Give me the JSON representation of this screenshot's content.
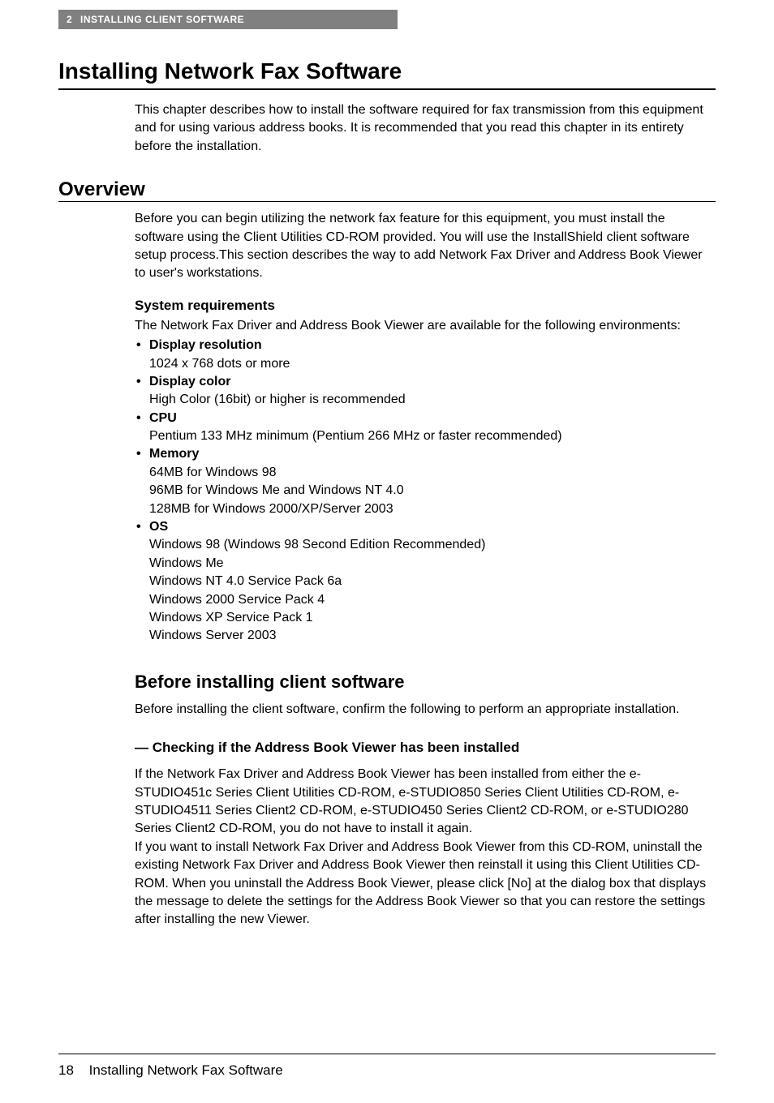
{
  "header": {
    "chapter_num": "2",
    "chapter_title": "INSTALLING CLIENT SOFTWARE"
  },
  "title": "Installing Network Fax Software",
  "intro": "This chapter describes how to install the software required for fax transmission from this equipment and for using various address books. It is recommended that you read this chapter in its entirety before the installation.",
  "overview": {
    "heading": "Overview",
    "body": "Before you can begin utilizing the network fax feature for this equipment, you must install the software using the Client Utilities CD-ROM provided. You will use the InstallShield client software setup process.This section describes the way to add Network Fax Driver and Address Book Viewer to user's workstations.",
    "sysreq_heading": "System requirements",
    "sysreq_intro": "The Network Fax Driver and Address Book Viewer are available for the following environments:",
    "requirements": [
      {
        "label": "Display resolution",
        "desc": "1024 x 768 dots or more"
      },
      {
        "label": "Display color",
        "desc": "High Color (16bit) or higher is recommended"
      },
      {
        "label": "CPU",
        "desc": "Pentium 133 MHz minimum (Pentium 266 MHz or faster recommended)"
      },
      {
        "label": "Memory",
        "desc": "64MB for Windows 98\n96MB for Windows Me and Windows NT 4.0\n128MB for Windows 2000/XP/Server 2003"
      },
      {
        "label": "OS",
        "desc": "Windows 98 (Windows 98 Second Edition Recommended)\nWindows Me\nWindows NT 4.0 Service Pack 6a\nWindows 2000 Service Pack 4\nWindows XP Service Pack 1\nWindows Server 2003"
      }
    ]
  },
  "before_install": {
    "heading": "Before installing client software",
    "body": "Before installing the client software, confirm the following to perform an appropriate installation.",
    "check_heading": "— Checking if the Address Book Viewer has been installed",
    "check_body": "If the Network Fax Driver and Address Book Viewer has been installed from either the e-STUDIO451c Series Client Utilities CD-ROM, e-STUDIO850 Series Client Utilities CD-ROM, e-STUDIO4511 Series Client2 CD-ROM, e-STUDIO450 Series Client2 CD-ROM, or e-STUDIO280 Series Client2 CD-ROM, you do not have to install it again.\nIf you want to install Network Fax Driver and Address Book Viewer from this CD-ROM, uninstall the existing Network Fax Driver and Address Book Viewer then reinstall it using this Client Utilities CD-ROM. When you uninstall the Address Book Viewer, please click [No] at the dialog box that displays the message to delete the settings for the Address Book Viewer so that you can restore the settings after installing the new Viewer."
  },
  "footer": {
    "page_num": "18",
    "footer_title": "Installing Network Fax Software"
  }
}
